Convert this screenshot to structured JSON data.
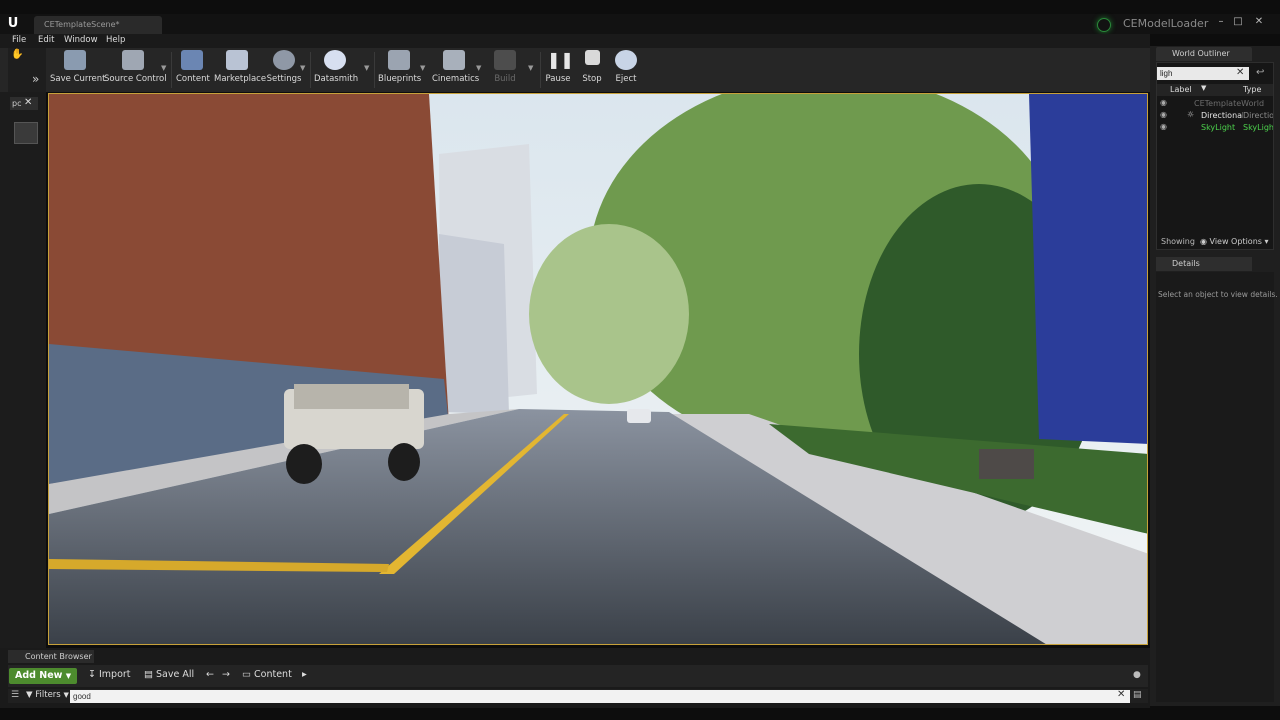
{
  "window": {
    "document_tab": "CETemplateScene*",
    "app_title": "CEModelLoader",
    "controls": [
      "–",
      "□",
      "✕"
    ]
  },
  "menu": [
    "File",
    "Edit",
    "Window",
    "Help"
  ],
  "toolbar": {
    "buttons": [
      {
        "label": "Save Current",
        "icon": "save-icon"
      },
      {
        "label": "Source Control",
        "icon": "source-control-icon"
      },
      {
        "label": "Content",
        "icon": "content-icon"
      },
      {
        "label": "Marketplace",
        "icon": "marketplace-icon"
      },
      {
        "label": "Settings",
        "icon": "settings-icon"
      },
      {
        "label": "Datasmith",
        "icon": "datasmith-icon"
      },
      {
        "label": "Blueprints",
        "icon": "blueprints-icon"
      },
      {
        "label": "Cinematics",
        "icon": "cinematics-icon"
      },
      {
        "label": "Build",
        "icon": "build-icon"
      },
      {
        "label": "Pause",
        "icon": "pause-icon"
      },
      {
        "label": "Stop",
        "icon": "stop-icon"
      },
      {
        "label": "Eject",
        "icon": "eject-icon"
      }
    ]
  },
  "left_panel": {
    "tab_label": "pc"
  },
  "world_outliner": {
    "tab_label": "World Outliner",
    "search_value": "ligh",
    "columns": [
      "Label",
      "Type"
    ],
    "rows": [
      {
        "label": "CETemplateWorld",
        "type": ""
      },
      {
        "label": "DirectionalLight",
        "type": "Direction"
      },
      {
        "label": "SkyLight",
        "type": "SkyLigh"
      }
    ],
    "showing_label": "Showing",
    "view_options_label": "View Options"
  },
  "details": {
    "tab_label": "Details",
    "empty_message": "Select an object to view details."
  },
  "content_browser": {
    "tab_label": "Content Browser",
    "add_new_label": "Add New",
    "import_label": "Import",
    "save_all_label": "Save All",
    "path_label": "Content",
    "filters_label": "Filters",
    "search_value": "good"
  },
  "colors": {
    "accent_green": "#4d8b2e",
    "viewport_border": "#c7a13a",
    "outliner_highlight": "#4cd24c"
  }
}
